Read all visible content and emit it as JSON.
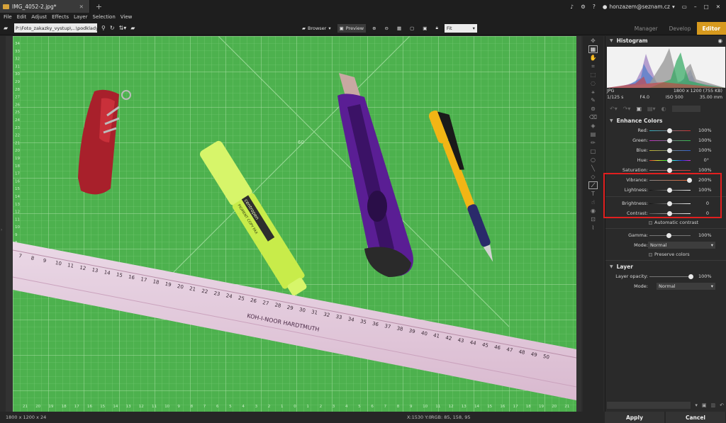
{
  "window": {
    "tab_title": "IMG_4052-2.jpg*",
    "user": "honzazem@seznam.cz"
  },
  "menu": [
    "File",
    "Edit",
    "Adjust",
    "Effects",
    "Layer",
    "Selection",
    "View"
  ],
  "toolbar": {
    "path": "P:\\Foto_zakazky_vystup\\...\\podklady",
    "browser": "Browser",
    "preview": "Preview",
    "zoom": "Fit"
  },
  "modes": [
    "Manager",
    "Develop",
    "Editor"
  ],
  "panel": {
    "histogram_title": "Histogram",
    "file_type": "JPG",
    "dimensions": "1800 x 1200 (755 KB)",
    "shutter": "1/125 s",
    "aperture": "F4.0",
    "iso": "ISO 500",
    "focal": "35.00 mm",
    "enhance_title": "Enhance Colors",
    "sliders": [
      {
        "label": "Red:",
        "value": "100%",
        "pos": 0.5
      },
      {
        "label": "Green:",
        "value": "100%",
        "pos": 0.5
      },
      {
        "label": "Blue:",
        "value": "100%",
        "pos": 0.5
      },
      {
        "label": "Hue:",
        "value": "0°",
        "pos": 0.5
      },
      {
        "label": "Saturation:",
        "value": "100%",
        "pos": 0.5
      },
      {
        "label": "Vibrance:",
        "value": "200%",
        "pos": 1.0
      },
      {
        "label": "Lightness:",
        "value": "100%",
        "pos": 0.5
      },
      {
        "label": "Brightness:",
        "value": "0",
        "pos": 0.5
      },
      {
        "label": "Contrast:",
        "value": "0",
        "pos": 0.5
      }
    ],
    "auto_contrast": "Automatic contrast",
    "gamma_label": "Gamma:",
    "gamma_value": "100%",
    "mode_label": "Mode:",
    "mode_value": "Normal",
    "preserve": "Preserve colors",
    "layer_title": "Layer",
    "opacity_label": "Layer opacity:",
    "opacity_value": "100%",
    "layer_mode_label": "Mode:",
    "layer_mode_value": "Normal"
  },
  "status": {
    "size": "1800 x 1200 x 24",
    "coords": "X:1530 Y:0",
    "rgb": "RGB: 85, 158, 95"
  },
  "buttons": {
    "apply": "Apply",
    "cancel": "Cancel"
  },
  "photo": {
    "marker_text": "PIGMENT  COPY  FAX",
    "marker_brand": "centropen",
    "ruler_brand": "KOH-I-NOOR HARDTMUTH",
    "mat_label": "60",
    "ruler_numbers": [
      "7",
      "8",
      "9",
      "10",
      "11",
      "12",
      "13",
      "14",
      "15",
      "16",
      "17",
      "18",
      "19",
      "20",
      "21",
      "22",
      "23",
      "24",
      "25",
      "26",
      "27",
      "28",
      "29",
      "30",
      "31",
      "32",
      "33",
      "34",
      "35",
      "36",
      "37",
      "38",
      "39",
      "40",
      "41",
      "42",
      "43",
      "44",
      "45",
      "46",
      "47",
      "48",
      "49",
      "50"
    ],
    "bottom_numbers": [
      "21",
      "20",
      "19",
      "18",
      "17",
      "16",
      "15",
      "14",
      "13",
      "12",
      "11",
      "10",
      "9",
      "8",
      "7",
      "6",
      "5",
      "4",
      "3",
      "2",
      "1",
      "0",
      "1",
      "2",
      "3",
      "4",
      "5",
      "6",
      "7",
      "8",
      "9",
      "10",
      "11",
      "12",
      "13",
      "14",
      "15",
      "16",
      "17",
      "18",
      "19",
      "20",
      "21",
      "22"
    ],
    "side_numbers": [
      "34",
      "33",
      "32",
      "31",
      "30",
      "29",
      "28",
      "27",
      "26",
      "25",
      "24",
      "23",
      "22",
      "21",
      "20",
      "19",
      "18",
      "17",
      "16",
      "15",
      "14",
      "13",
      "12",
      "11",
      "10",
      "9",
      "8"
    ]
  }
}
